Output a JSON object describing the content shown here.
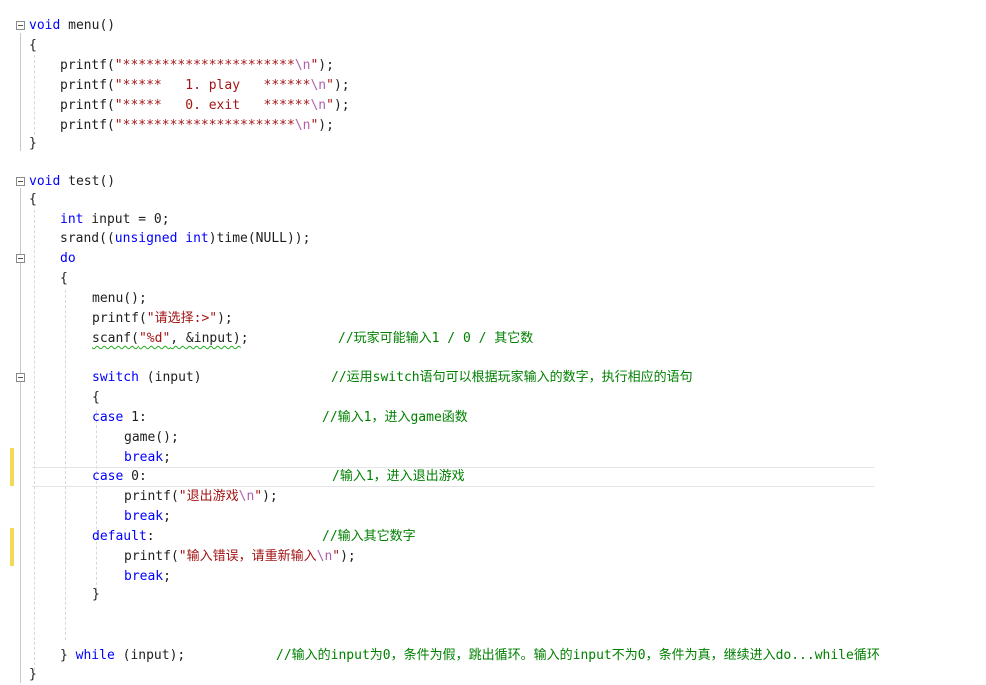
{
  "lines": [
    {
      "id": "l1",
      "tokens": [
        {
          "k": "kw",
          "t": "void"
        },
        {
          "k": "tx",
          "t": " menu()"
        }
      ]
    },
    {
      "id": "l2",
      "tokens": [
        {
          "k": "tx",
          "t": "{"
        }
      ]
    },
    {
      "id": "l3",
      "tokens": [
        {
          "k": "tx",
          "t": "printf("
        },
        {
          "k": "str",
          "t": "\"**********************"
        },
        {
          "k": "esc",
          "t": "\\n"
        },
        {
          "k": "str",
          "t": "\""
        },
        {
          "k": "tx",
          "t": ");"
        }
      ]
    },
    {
      "id": "l4",
      "tokens": [
        {
          "k": "tx",
          "t": "printf("
        },
        {
          "k": "str",
          "t": "\"*****   1. play   ******"
        },
        {
          "k": "esc",
          "t": "\\n"
        },
        {
          "k": "str",
          "t": "\""
        },
        {
          "k": "tx",
          "t": ");"
        }
      ]
    },
    {
      "id": "l5",
      "tokens": [
        {
          "k": "tx",
          "t": "printf("
        },
        {
          "k": "str",
          "t": "\"*****   0. exit   ******"
        },
        {
          "k": "esc",
          "t": "\\n"
        },
        {
          "k": "str",
          "t": "\""
        },
        {
          "k": "tx",
          "t": ");"
        }
      ]
    },
    {
      "id": "l6",
      "tokens": [
        {
          "k": "tx",
          "t": "printf("
        },
        {
          "k": "str",
          "t": "\"**********************"
        },
        {
          "k": "esc",
          "t": "\\n"
        },
        {
          "k": "str",
          "t": "\""
        },
        {
          "k": "tx",
          "t": ");"
        }
      ]
    },
    {
      "id": "l7",
      "tokens": [
        {
          "k": "tx",
          "t": "}"
        }
      ]
    },
    {
      "id": "l8",
      "tokens": [
        {
          "k": "kw",
          "t": "void"
        },
        {
          "k": "tx",
          "t": " test()"
        }
      ]
    },
    {
      "id": "l9",
      "tokens": [
        {
          "k": "tx",
          "t": "{"
        }
      ]
    },
    {
      "id": "l10",
      "tokens": [
        {
          "k": "kw",
          "t": "int"
        },
        {
          "k": "tx",
          "t": " input = 0;"
        }
      ]
    },
    {
      "id": "l11",
      "tokens": [
        {
          "k": "tx",
          "t": "srand(("
        },
        {
          "k": "kw",
          "t": "unsigned int"
        },
        {
          "k": "tx",
          "t": ")time(NULL));"
        }
      ]
    },
    {
      "id": "l12",
      "tokens": [
        {
          "k": "kw",
          "t": "do"
        }
      ]
    },
    {
      "id": "l13",
      "tokens": [
        {
          "k": "tx",
          "t": "{"
        }
      ]
    },
    {
      "id": "l14",
      "tokens": [
        {
          "k": "tx",
          "t": "menu();"
        }
      ]
    },
    {
      "id": "l15",
      "tokens": [
        {
          "k": "tx",
          "t": "printf("
        },
        {
          "k": "str",
          "t": "\"请选择:>\""
        },
        {
          "k": "tx",
          "t": ");"
        }
      ]
    },
    {
      "id": "l16",
      "tokens": [
        {
          "k": "sq",
          "t": "scanf("
        },
        {
          "k": "sqstr",
          "t": "\"%d\""
        },
        {
          "k": "sq",
          "t": ", &input)"
        },
        {
          "k": "tx",
          "t": ";"
        }
      ],
      "comment": "//玩家可能输入1 / 0 / 其它数"
    },
    {
      "id": "l17",
      "tokens": [
        {
          "k": "kw",
          "t": "switch"
        },
        {
          "k": "tx",
          "t": " (input)"
        }
      ],
      "comment": "//运用switch语句可以根据玩家输入的数字，执行相应的语句"
    },
    {
      "id": "l18",
      "tokens": [
        {
          "k": "tx",
          "t": "{"
        }
      ]
    },
    {
      "id": "l19",
      "tokens": [
        {
          "k": "kw",
          "t": "case"
        },
        {
          "k": "tx",
          "t": " 1:"
        }
      ],
      "comment": "//输入1，进入game函数"
    },
    {
      "id": "l20",
      "tokens": [
        {
          "k": "tx",
          "t": "game();"
        }
      ]
    },
    {
      "id": "l21",
      "tokens": [
        {
          "k": "kw",
          "t": "break"
        },
        {
          "k": "tx",
          "t": ";"
        }
      ]
    },
    {
      "id": "l22",
      "tokens": [
        {
          "k": "kw",
          "t": "case"
        },
        {
          "k": "tx",
          "t": " 0:"
        }
      ],
      "comment": "/输入1，进入退出游戏"
    },
    {
      "id": "l23",
      "tokens": [
        {
          "k": "tx",
          "t": "printf("
        },
        {
          "k": "str",
          "t": "\"退出游戏"
        },
        {
          "k": "esc",
          "t": "\\n"
        },
        {
          "k": "str",
          "t": "\""
        },
        {
          "k": "tx",
          "t": ");"
        }
      ]
    },
    {
      "id": "l24",
      "tokens": [
        {
          "k": "kw",
          "t": "break"
        },
        {
          "k": "tx",
          "t": ";"
        }
      ]
    },
    {
      "id": "l25",
      "tokens": [
        {
          "k": "kw",
          "t": "default"
        },
        {
          "k": "tx",
          "t": ":"
        }
      ],
      "comment": "//输入其它数字"
    },
    {
      "id": "l26",
      "tokens": [
        {
          "k": "tx",
          "t": "printf("
        },
        {
          "k": "str",
          "t": "\"输入错误，请重新输入"
        },
        {
          "k": "esc",
          "t": "\\n"
        },
        {
          "k": "str",
          "t": "\""
        },
        {
          "k": "tx",
          "t": ");"
        }
      ]
    },
    {
      "id": "l27",
      "tokens": [
        {
          "k": "kw",
          "t": "break"
        },
        {
          "k": "tx",
          "t": ";"
        }
      ]
    },
    {
      "id": "l28",
      "tokens": [
        {
          "k": "tx",
          "t": "}"
        }
      ]
    },
    {
      "id": "l29",
      "tokens": [
        {
          "k": "tx",
          "t": "} "
        },
        {
          "k": "kw",
          "t": "while"
        },
        {
          "k": "tx",
          "t": " (input);"
        }
      ],
      "comment": "//输入的input为0，条件为假，跳出循环。输入的input不为0，条件为真，继续进入do...while循环"
    },
    {
      "id": "l30",
      "tokens": [
        {
          "k": "tx",
          "t": "}"
        }
      ]
    }
  ]
}
